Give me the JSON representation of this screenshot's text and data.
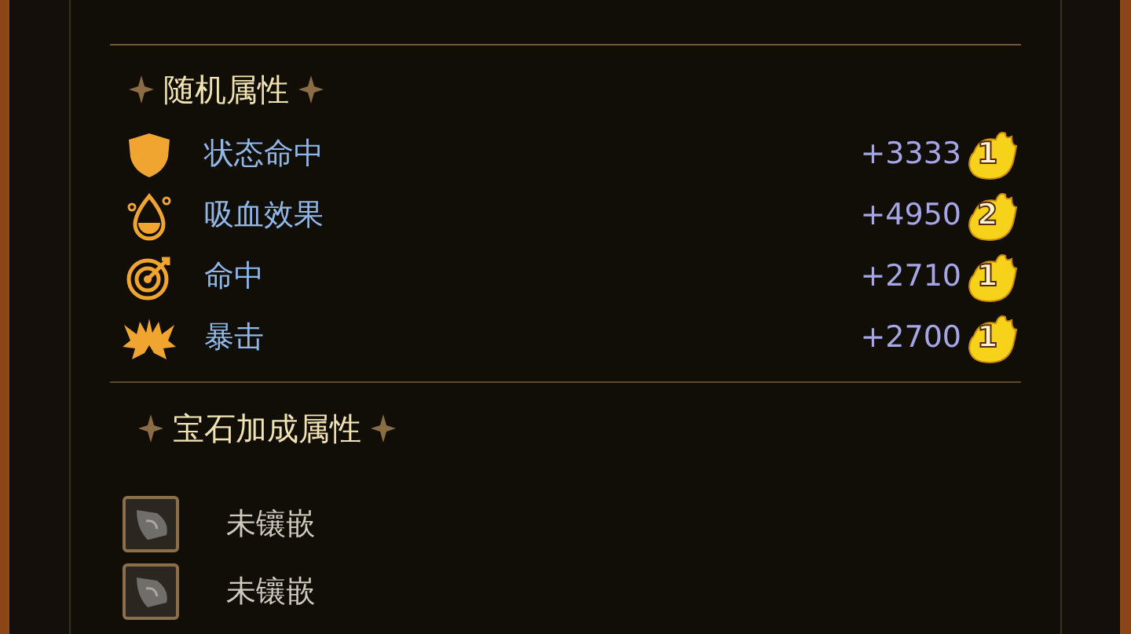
{
  "random_attributes": {
    "title": "随机属性",
    "rows": [
      {
        "kind": "shield",
        "label": "状态命中",
        "value": "+3333",
        "grade": "1"
      },
      {
        "kind": "drop",
        "label": "吸血效果",
        "value": "+4950",
        "grade": "2"
      },
      {
        "kind": "target",
        "label": "命中",
        "value": "+2710",
        "grade": "1"
      },
      {
        "kind": "burst",
        "label": "暴击",
        "value": "+2700",
        "grade": "1"
      }
    ]
  },
  "gem_attributes": {
    "title": "宝石加成属性",
    "slots": [
      {
        "label": "未镶嵌"
      },
      {
        "label": "未镶嵌"
      }
    ]
  }
}
